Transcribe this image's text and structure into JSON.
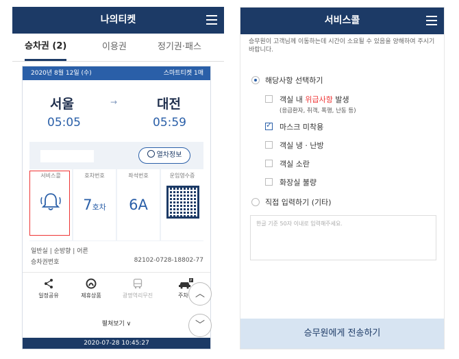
{
  "left": {
    "header_title": "나의티켓",
    "tabs": [
      {
        "label": "승차권 (2)"
      },
      {
        "label": "이용권"
      },
      {
        "label": "정기권·패스"
      }
    ],
    "ticket": {
      "date": "2020년 8월 12일 (수)",
      "ticket_type": "스마트티켓 1매",
      "origin": "서울",
      "origin_time": "05:05",
      "destination": "대전",
      "destination_time": "05:59",
      "arrow": "→",
      "train_info_button": "열차정보",
      "cells": [
        {
          "label": "서비스콜",
          "value": ""
        },
        {
          "label": "호차번호",
          "value": "7",
          "unit": "호차"
        },
        {
          "label": "좌석번호",
          "value": "6A"
        },
        {
          "label": "운임영수증",
          "value": ""
        }
      ],
      "class_info": "일반실 | 순방향 | 어른",
      "ticket_number_label": "승차권번호",
      "ticket_number": "82102-0728-18802-77"
    },
    "actions": [
      {
        "label": "일정공유",
        "icon": "share-icon"
      },
      {
        "label": "제휴상품",
        "icon": "partner-icon"
      },
      {
        "label": "광명역리무진",
        "icon": "bus-icon"
      },
      {
        "label": "주차장",
        "icon": "parking-car-icon"
      }
    ],
    "more_label": "펼쳐보기 ∨",
    "footer_timestamp": "2020-07-28 10:45:27"
  },
  "right": {
    "header_title": "서비스콜",
    "notice": "승무원이 고객님께 이동하는데 시간이 소요될 수 있음을 양해하여 주시기 바랍니다.",
    "radio_select": "해당사항 선택하기",
    "options": [
      {
        "label_pre": "객실 내 ",
        "label_red": "위급사항",
        "label_post": " 발생",
        "sub": "(응급환자, 취객, 폭행, 난동 등)",
        "checked": false
      },
      {
        "label": "마스크 미착용",
        "checked": true
      },
      {
        "label": "객실 냉 · 난방",
        "checked": false
      },
      {
        "label": "객실 소란",
        "checked": false
      },
      {
        "label": "화장실 불량",
        "checked": false
      }
    ],
    "radio_direct": "직접 입력하기 (기타)",
    "textarea_placeholder": "한글 기준 50자 이내로 입력해주세요.",
    "send_button": "승무원에게 전송하기"
  },
  "colors": {
    "navy": "#1c3a66",
    "accent_blue": "#2a5fa8",
    "highlight_red": "#e33333",
    "send_bg": "#d7e4f2"
  }
}
